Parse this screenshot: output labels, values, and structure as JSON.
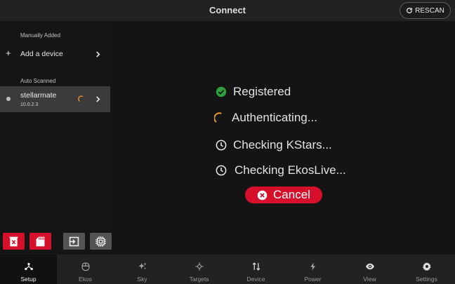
{
  "header": {
    "title": "Connect",
    "rescan_label": "RESCAN"
  },
  "sidebar": {
    "manual_section": "Manually Added",
    "add_device_label": "Add a device",
    "auto_section": "Auto Scanned",
    "devices": [
      {
        "name": "stellarmate",
        "ip": "10.0.2.3",
        "status": "connecting"
      }
    ]
  },
  "status": {
    "steps": [
      {
        "label": "Registered",
        "state": "done",
        "icon": "check-circle-icon"
      },
      {
        "label": "Authenticating...",
        "state": "in-progress",
        "icon": "spinner-icon"
      },
      {
        "label": "Checking KStars...",
        "state": "pending",
        "icon": "clock-icon"
      },
      {
        "label": "Checking EkosLive...",
        "state": "pending",
        "icon": "clock-icon"
      }
    ],
    "cancel_label": "Cancel"
  },
  "toolbar": {
    "buttons": [
      {
        "name": "delete-device-button",
        "icon": "trash-x-icon"
      },
      {
        "name": "sd-card-button",
        "icon": "sd-card-icon"
      },
      {
        "name": "login-button",
        "icon": "enter-icon"
      },
      {
        "name": "chip-button",
        "icon": "chip-icon"
      }
    ]
  },
  "nav": {
    "active": "Setup",
    "items": [
      {
        "label": "Setup",
        "icon": "setup-icon"
      },
      {
        "label": "Ekos",
        "icon": "ekos-icon"
      },
      {
        "label": "Sky",
        "icon": "sky-icon"
      },
      {
        "label": "Targets",
        "icon": "targets-icon"
      },
      {
        "label": "Device",
        "icon": "device-icon"
      },
      {
        "label": "Power",
        "icon": "power-icon"
      },
      {
        "label": "View",
        "icon": "view-icon"
      },
      {
        "label": "Settings",
        "icon": "settings-icon"
      }
    ]
  },
  "colors": {
    "accent_red": "#d6102a",
    "success_green": "#2e9e3e",
    "spinner_orange": "#f0962a",
    "background": "#141414",
    "bar": "#222222"
  }
}
